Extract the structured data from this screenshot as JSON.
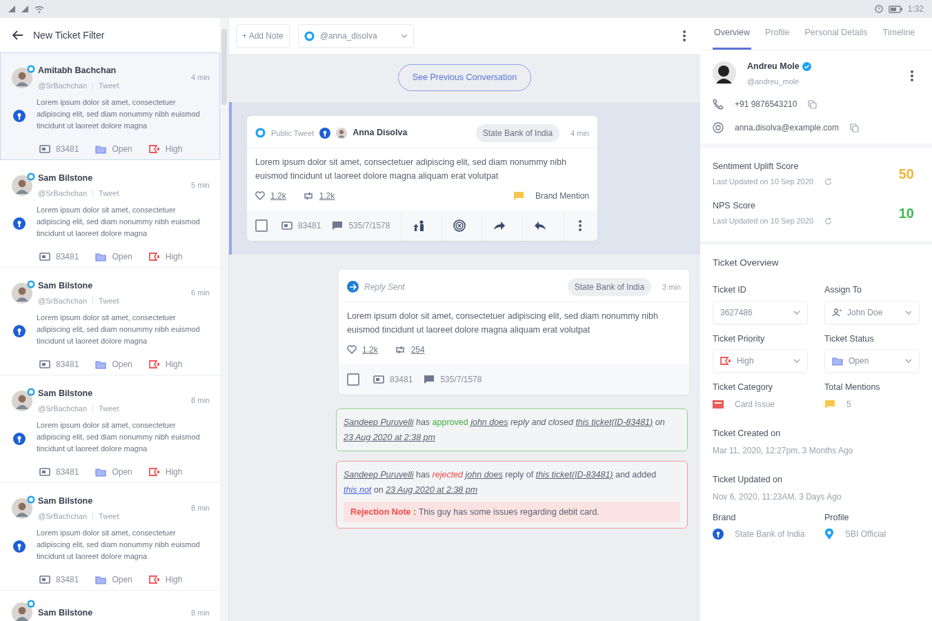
{
  "status_bar": {
    "time": "1:32"
  },
  "left_panel": {
    "title": "New Ticket Filter",
    "tickets": [
      {
        "name": "Amitabh Bachchan",
        "handle": "@SrBachchan",
        "source": "Tweet",
        "time": "4 min",
        "text": "Lorem ipsum dolor sit amet, consectetuer adipiscing elit, sed diam nonummy nibh euismod tincidunt ut laoreet dolore magna",
        "ticket_id": "83481",
        "status": "Open",
        "priority": "High",
        "selected": true
      },
      {
        "name": "Sam Bilstone",
        "handle": "@SrBachchan",
        "source": "Tweet",
        "time": "5 min",
        "text": "Lorem ipsum dolor sit amet, consectetuer adipiscing elit, sed diam nonummy nibh euismod tincidunt ut laoreet dolore magna",
        "ticket_id": "83481",
        "status": "Open",
        "priority": "High",
        "selected": false
      },
      {
        "name": "Sam Bilstone",
        "handle": "@SrBachchan",
        "source": "Tweet",
        "time": "6 min",
        "text": "Lorem ipsum dolor sit amet, consectetuer adipiscing elit, sed diam nonummy nibh euismod tincidunt ut laoreet dolore magna",
        "ticket_id": "83481",
        "status": "Open",
        "priority": "High",
        "selected": false
      },
      {
        "name": "Sam Bilstone",
        "handle": "@SrBachchan",
        "source": "Tweet",
        "time": "8 min",
        "text": "Lorem ipsum dolor sit amet, consectetuer adipiscing elit, sed diam nonummy nibh euismod tincidunt ut laoreet dolore magna",
        "ticket_id": "83481",
        "status": "Open",
        "priority": "High",
        "selected": false
      },
      {
        "name": "Sam Bilstone",
        "handle": "@SrBachchan",
        "source": "Tweet",
        "time": "8 min",
        "text": "Lorem ipsum dolor sit amet, consectetuer adipiscing elit, sed diam nonummy nibh euismod tincidunt ut laoreet dolore magna",
        "ticket_id": "83481",
        "status": "Open",
        "priority": "High",
        "selected": false
      },
      {
        "name": "Sam Bilstone",
        "time": "8 min",
        "selected": false
      }
    ]
  },
  "toolbar": {
    "add_note": "+ Add Note",
    "account": "@anna_disolva"
  },
  "previous_button": "See Previous Conversation",
  "messages": [
    {
      "kind": "tweet",
      "highlighted": true,
      "label": "Public Tweet",
      "author": "Anna Disolva",
      "brand": "State Bank of India",
      "time": "4 min",
      "text": "Lorem ipsum dolor sit amet, consectetuer adipiscing elit, sed diam nonummy nibh euismod tincidunt ut laoreet dolore magna aliquam erat volutpat",
      "likes": "1.2k",
      "retweets": "1.2k",
      "tag": "Brand Mention",
      "checked": false,
      "ticket_id": "83481",
      "ref": "535/7/1578"
    },
    {
      "kind": "reply",
      "highlighted": false,
      "label": "Reply Sent",
      "brand": "State Bank of India",
      "time": "3 min",
      "text": "Lorem ipsum dolor sit amet, consectetuer adipiscing elit, sed diam nonummy nibh euismod tincidunt ut laoreet dolore magna aliquam erat volutpat",
      "likes": "1.2k",
      "retweets": "254",
      "checked": false,
      "ticket_id": "83481",
      "ref": "535/7/1578"
    }
  ],
  "activity": [
    {
      "kind": "approved",
      "segments": [
        {
          "kind": "link",
          "text": "Sandeep Puruvelli"
        },
        {
          "kind": "text",
          "text": " has "
        },
        {
          "kind": "approved",
          "text": "approved "
        },
        {
          "kind": "link",
          "text": "john does"
        },
        {
          "kind": "text",
          "text": " reply and closed "
        },
        {
          "kind": "link",
          "text": "this ticket(ID-83481)"
        },
        {
          "kind": "text",
          "text": " on "
        },
        {
          "kind": "link",
          "text": "23 Aug 2020 at 2:38 pm"
        }
      ]
    },
    {
      "kind": "rejected",
      "segments": [
        {
          "kind": "link",
          "text": "Sandeep Puruvelli"
        },
        {
          "kind": "text",
          "text": " has "
        },
        {
          "kind": "rejected",
          "text": "rejected "
        },
        {
          "kind": "link",
          "text": "john does"
        },
        {
          "kind": "text",
          "text": " reply of "
        },
        {
          "kind": "link",
          "text": "this ticket(ID-83481)"
        },
        {
          "kind": "text",
          "text": " and added "
        },
        {
          "kind": "ref",
          "text": "this not"
        },
        {
          "kind": "text",
          "text": " on "
        },
        {
          "kind": "link",
          "text": "23 Aug 2020 at 2:38 pm"
        }
      ],
      "note_label": "Rejection Note :",
      "note": "This guy has some issues regarding debit card."
    }
  ],
  "right_panel": {
    "tabs": [
      {
        "label": "Overview",
        "selected": true
      },
      {
        "label": "Profile",
        "selected": false
      },
      {
        "label": "Personal Details",
        "selected": false
      },
      {
        "label": "Timeline",
        "selected": false
      }
    ],
    "profile": {
      "name": "Andreu Mole",
      "handle": "@andreu_mole",
      "phone": "+91 9876543210",
      "email": "anna.disolva@example.com"
    },
    "scores": [
      {
        "label": "Sentiment Uplift Score",
        "updated": "Last Updated on 10 Sep 2020",
        "value": "50",
        "color": "#f5b335"
      },
      {
        "label": "NPS Score",
        "updated": "Last Updated on 10 Sep 2020",
        "value": "10",
        "color": "#3dbb4c"
      }
    ],
    "ticket_overview": {
      "title": "Ticket Overview",
      "fields": [
        {
          "kind": "select",
          "label": "Ticket ID",
          "value": "3627486"
        },
        {
          "kind": "assignee",
          "label": "Assign To",
          "value": "John Doe"
        },
        {
          "kind": "priority",
          "label": "Ticket Priority",
          "value": "High"
        },
        {
          "kind": "status",
          "label": "Ticket Status",
          "value": "Open"
        },
        {
          "kind": "category",
          "label": "Ticket Category",
          "value": "Card Issue"
        },
        {
          "kind": "mentions",
          "label": "Total Mentions",
          "value": "5"
        },
        {
          "kind": "date",
          "label": "Ticket Created on",
          "value": "Mar 11, 2020, 12:27pm, 3 Months Ago"
        },
        {
          "kind": "date",
          "label": "Ticket Updated on",
          "value": "Nov 6, 2020, 11:23AM, 3 Days Ago"
        },
        {
          "kind": "brand",
          "label": "Brand",
          "value": "State Bank of India"
        },
        {
          "kind": "profile",
          "label": "Profile",
          "value": "SBI Official"
        }
      ]
    }
  }
}
